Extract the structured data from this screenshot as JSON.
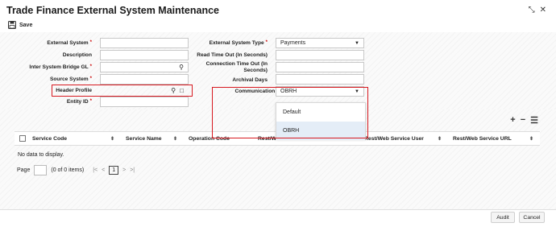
{
  "header": {
    "title": "Trade Finance External System Maintenance",
    "save_label": "Save",
    "minimize_icon": "collapse-icon",
    "close_icon": "close-icon"
  },
  "form": {
    "external_system": {
      "label": "External System",
      "required": "*",
      "value": ""
    },
    "description": {
      "label": "Description",
      "value": ""
    },
    "inter_system_bridge_gl": {
      "label": "Inter System Bridge GL",
      "required": "*",
      "value": ""
    },
    "source_system": {
      "label": "Source System",
      "required": "*",
      "value": ""
    },
    "header_profile": {
      "label": "Header Profile",
      "value": ""
    },
    "entity_id": {
      "label": "Entity ID",
      "required": "*",
      "value": ""
    },
    "external_system_type": {
      "label": "External System Type",
      "required": "*",
      "value": "Payments"
    },
    "read_timeout": {
      "label": "Read Time Out (In Seconds)",
      "value": ""
    },
    "connection_timeout": {
      "label_line1": "Connection Time Out (In",
      "label_line2": "Seconds)",
      "value": ""
    },
    "archival_days": {
      "label": "Archival Days",
      "value": ""
    },
    "communication_type": {
      "label": "Communication Type",
      "value": "OBRH",
      "options": [
        "Default",
        "OBRH"
      ]
    }
  },
  "grid": {
    "columns": [
      "Service Code",
      "Service Name",
      "Operation Code",
      "Rest/W",
      "Rest/Web Service User",
      "Rest/Web Service URL"
    ],
    "empty_text": "No data to display.",
    "page_label": "Page",
    "page_info": "(0 of 0 items)",
    "current_page": "1"
  },
  "footer": {
    "audit_label": "Audit",
    "cancel_label": "Cancel"
  },
  "colors": {
    "highlight": "#d71920",
    "active_option": "#e4edf7"
  }
}
